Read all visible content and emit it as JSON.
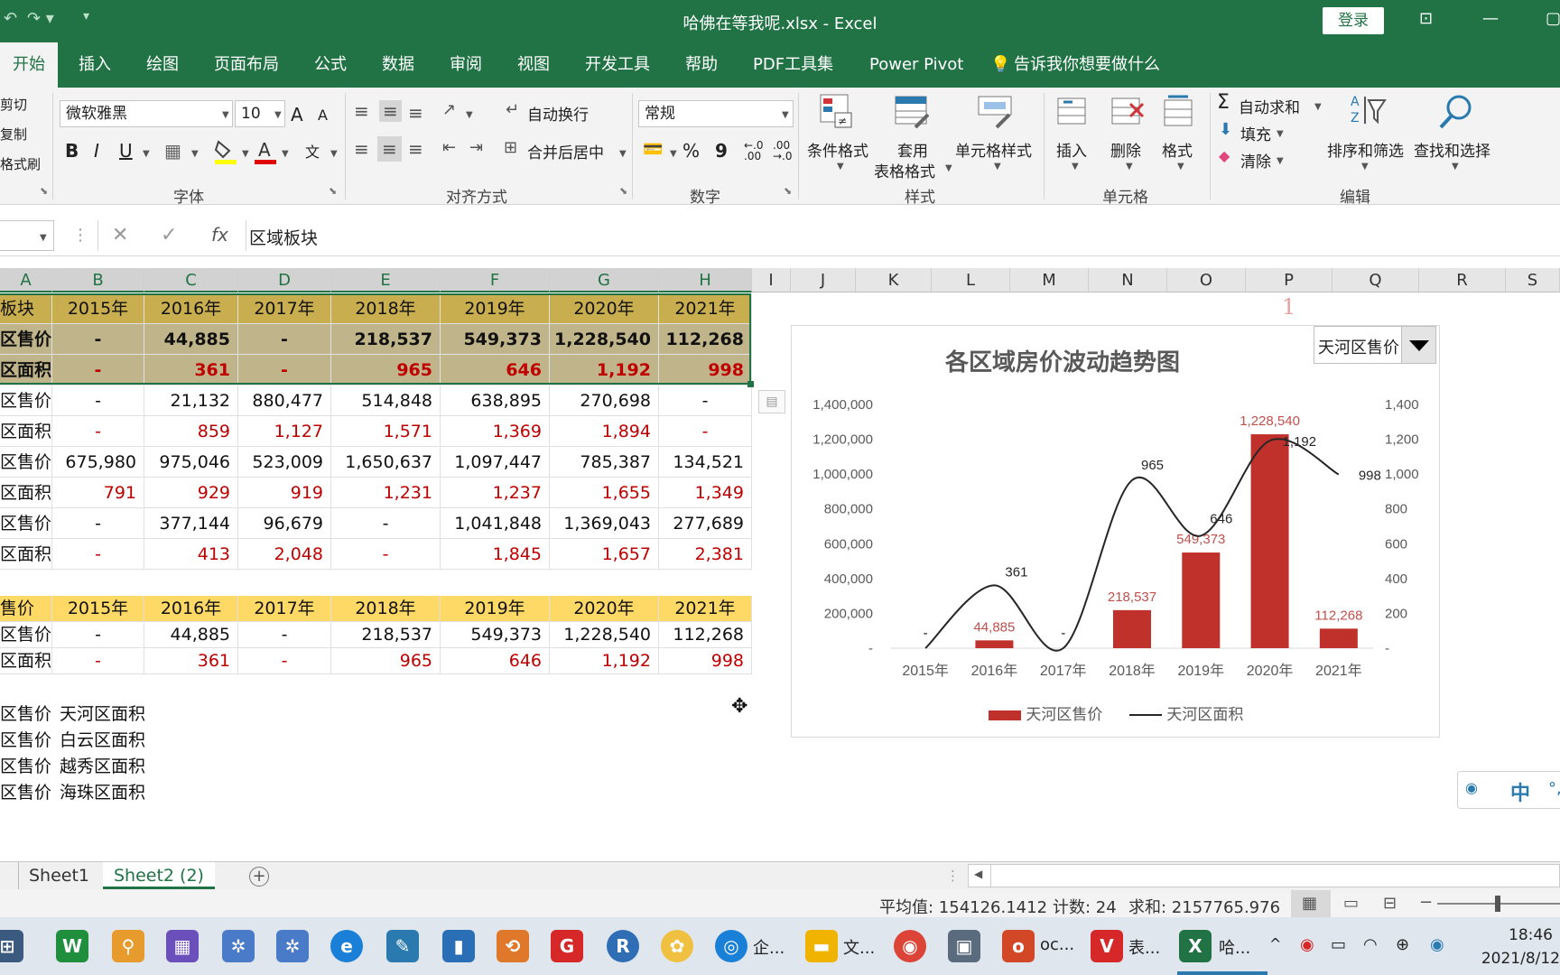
{
  "window": {
    "title": "哈佛在等我呢.xlsx  -  Excel",
    "login": "登录"
  },
  "tabs": [
    "开始",
    "插入",
    "绘图",
    "页面布局",
    "公式",
    "数据",
    "审阅",
    "视图",
    "开发工具",
    "帮助",
    "PDF工具集",
    "Power Pivot",
    "告诉我你想要做什么"
  ],
  "ribbon": {
    "clipboard": {
      "cut": "剪切",
      "copy": "复制",
      "painter": "格式刷"
    },
    "font": {
      "name": "微软雅黑",
      "size": "10",
      "bold": "B",
      "italic": "I",
      "underline": "U",
      "grow": "A",
      "shrink": "A",
      "group": "字体"
    },
    "align": {
      "wrap": "自动换行",
      "merge": "合并后居中",
      "group": "对齐方式"
    },
    "number": {
      "format": "常规",
      "percent": "%",
      "comma": "9",
      "group": "数字"
    },
    "styles": {
      "cond": "条件格式",
      "table1": "套用",
      "table2": "表格格式",
      "cell": "单元格样式",
      "group": "样式"
    },
    "cells": {
      "insert": "插入",
      "delete": "删除",
      "format": "格式",
      "group": "单元格"
    },
    "edit": {
      "autosum": "自动求和",
      "fill": "填充",
      "clear": "清除",
      "sort": "排序和筛选",
      "find": "查找和选择",
      "group": "编辑"
    }
  },
  "formula_bar": {
    "fx": "fx",
    "content": "区域板块"
  },
  "columns": [
    "A",
    "B",
    "C",
    "D",
    "E",
    "F",
    "G",
    "H",
    "I",
    "J",
    "K",
    "L",
    "M",
    "N",
    "O",
    "P",
    "Q",
    "R",
    "S"
  ],
  "table1": {
    "header": [
      "板块",
      "2015年",
      "2016年",
      "2017年",
      "2018年",
      "2019年",
      "2020年",
      "2021年"
    ],
    "rows": [
      [
        "区售价",
        "-",
        "44,885",
        "-",
        "218,537",
        "549,373",
        "1,228,540",
        "112,268"
      ],
      [
        "区面积",
        "-",
        "361",
        "-",
        "965",
        "646",
        "1,192",
        "998"
      ],
      [
        "区售价",
        "-",
        "21,132",
        "880,477",
        "514,848",
        "638,895",
        "270,698",
        "-"
      ],
      [
        "区面积",
        "-",
        "859",
        "1,127",
        "1,571",
        "1,369",
        "1,894",
        "-"
      ],
      [
        "区售价",
        "675,980",
        "975,046",
        "523,009",
        "1,650,637",
        "1,097,447",
        "785,387",
        "134,521"
      ],
      [
        "区面积",
        "791",
        "929",
        "919",
        "1,231",
        "1,237",
        "1,655",
        "1,349"
      ],
      [
        "区售价",
        "-",
        "377,144",
        "96,679",
        "-",
        "1,041,848",
        "1,369,043",
        "277,689"
      ],
      [
        "区面积",
        "-",
        "413",
        "2,048",
        "-",
        "1,845",
        "1,657",
        "2,381"
      ]
    ]
  },
  "table2": {
    "header": [
      "售价",
      "2015年",
      "2016年",
      "2017年",
      "2018年",
      "2019年",
      "2020年",
      "2021年"
    ],
    "rows": [
      [
        "区售价",
        "-",
        "44,885",
        "-",
        "218,537",
        "549,373",
        "1,228,540",
        "112,268"
      ],
      [
        "区面积",
        "-",
        "361",
        "-",
        "965",
        "646",
        "1,192",
        "998"
      ]
    ]
  },
  "list": [
    [
      "区售价",
      "天河区面积"
    ],
    [
      "区售价",
      "白云区面积"
    ],
    [
      "区售价",
      "越秀区面积"
    ],
    [
      "区售价",
      "海珠区面积"
    ]
  ],
  "page_number": "1",
  "chart_data": {
    "type": "bar",
    "title": "各区域房价波动趋势图",
    "categories": [
      "2015年",
      "2016年",
      "2017年",
      "2018年",
      "2019年",
      "2020年",
      "2021年"
    ],
    "series": [
      {
        "name": "天河区售价",
        "type": "bar",
        "axis": "left",
        "values": [
          0,
          44885,
          0,
          218537,
          549373,
          1228540,
          112268
        ],
        "labels": [
          "-",
          "44,885",
          "-",
          "218,537",
          "549,373",
          "1,228,540",
          "112,268"
        ],
        "color": "#c0312b"
      },
      {
        "name": "天河区面积",
        "type": "line",
        "smooth": true,
        "axis": "right",
        "values": [
          0,
          361,
          0,
          965,
          646,
          1192,
          998
        ],
        "labels": [
          "-",
          "361",
          "-",
          "965",
          "646",
          "1,192",
          "998"
        ],
        "color": "#262626"
      }
    ],
    "ylim_left": [
      0,
      1400000
    ],
    "ylim_right": [
      0,
      1400
    ],
    "yticks_left": [
      "-",
      "200,000",
      "400,000",
      "600,000",
      "800,000",
      "1,000,000",
      "1,200,000",
      "1,400,000"
    ],
    "yticks_right": [
      "-",
      "200",
      "400",
      "600",
      "800",
      "1,000",
      "1,200",
      "1,400"
    ],
    "legend_position": "bottom",
    "dropdown_value": "天河区售价"
  },
  "sheets": [
    "Sheet1",
    "Sheet2 (2)"
  ],
  "status": {
    "average": "平均值: 154126.1412",
    "count": "计数: 24",
    "sum": "求和: 2157765.976"
  },
  "taskbar": {
    "app1": "企...",
    "app2": "文...",
    "app3": "oc...",
    "app4": "表...",
    "app5": "哈...",
    "ime": "中",
    "time": "18:46",
    "date": "2021/8/12"
  }
}
